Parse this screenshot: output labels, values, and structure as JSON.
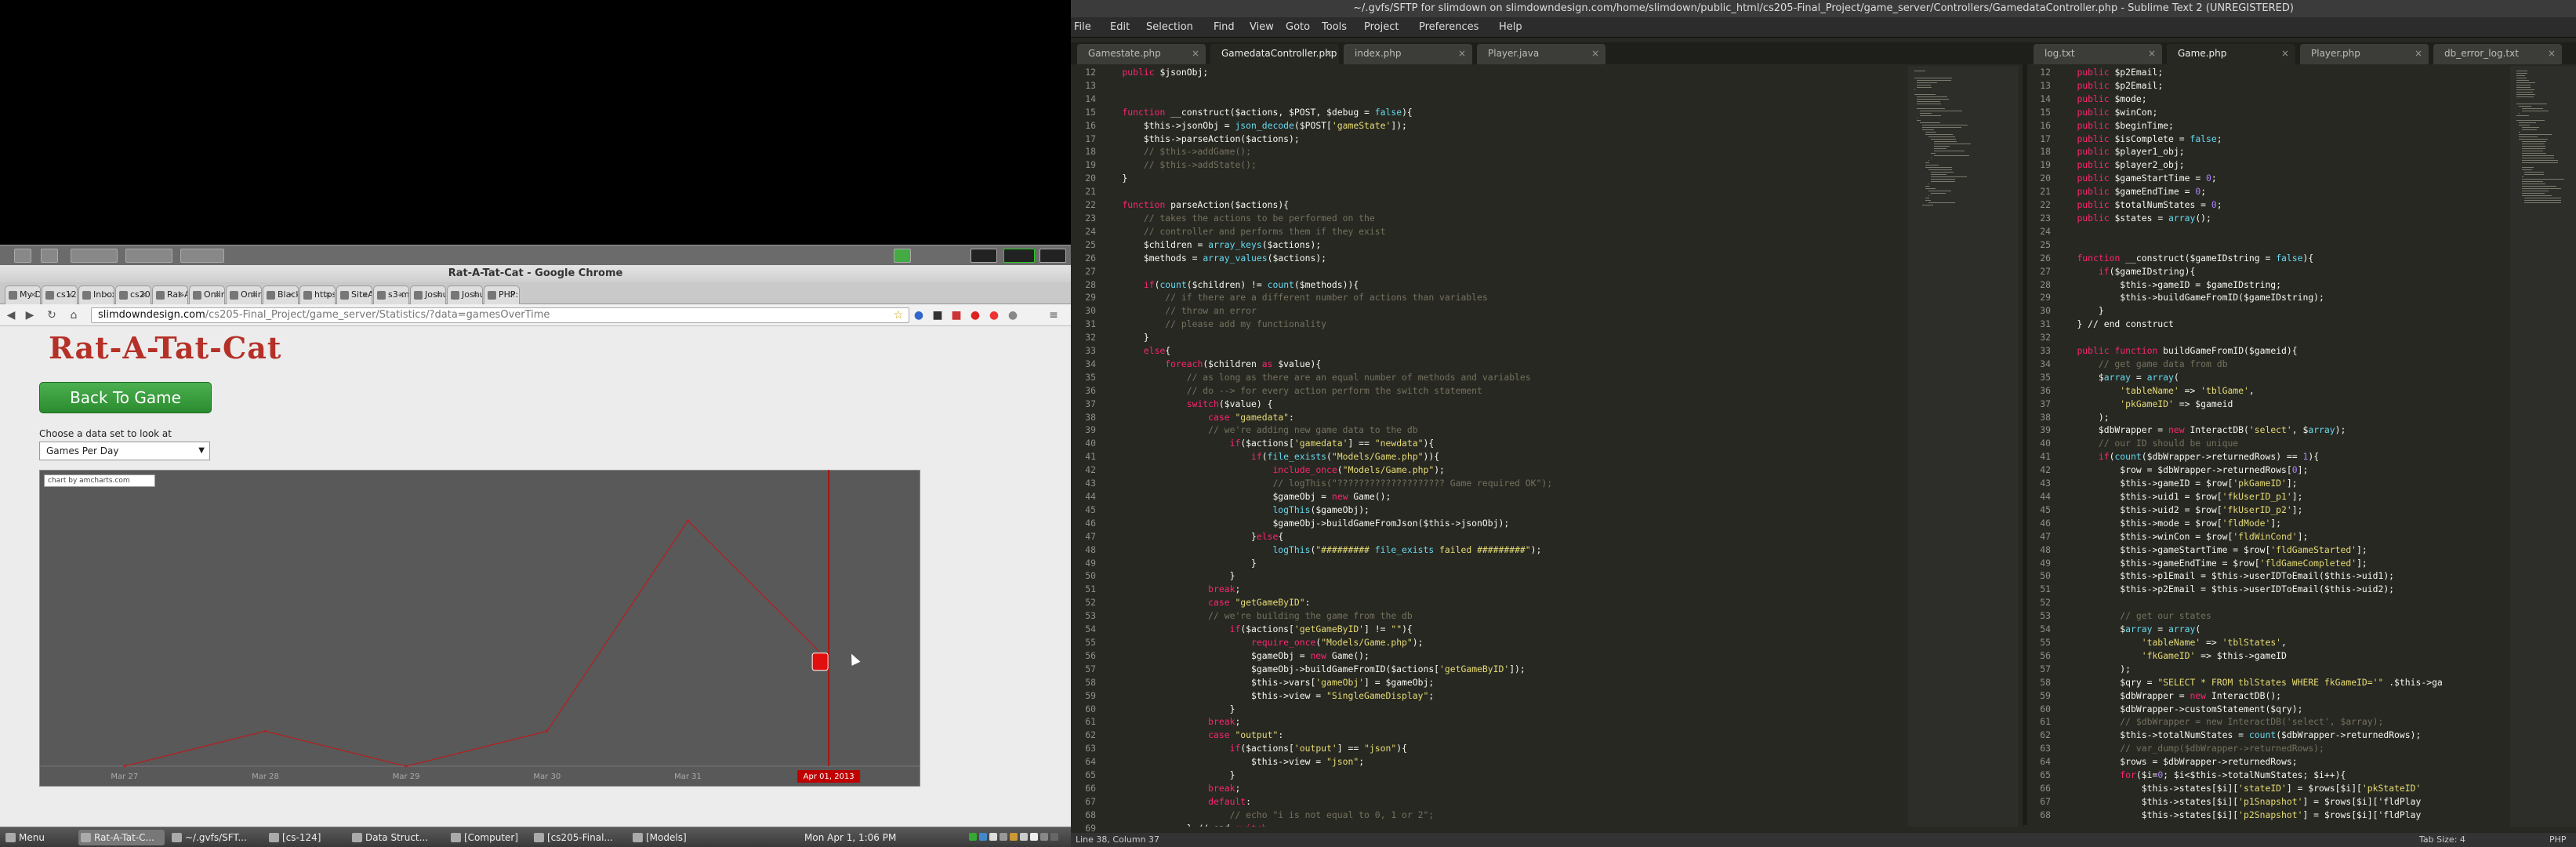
{
  "chrome": {
    "title": "Rat-A-Tat-Cat - Google Chrome",
    "url_host": "slimdowndesign.com",
    "url_path": "/cs205-Final_Project/game_server/Statistics/?data=gamesOverTime",
    "tabs": [
      "My Dri",
      "cs124",
      "Inbox (",
      "cs205",
      "Rat-A-",
      "Online",
      "Online",
      "Blackb",
      "https:",
      "SiteAd",
      "s3-myc",
      "Joshua",
      "Joshua",
      "PHP: fil"
    ]
  },
  "page": {
    "logo": "Rat-A-Tat-Cat",
    "back_button": "Back To Game",
    "choose_label": "Choose a data set to look at",
    "dataset_selected": "Games Per Day",
    "credit": "chart by amcharts.com"
  },
  "chart_data": {
    "type": "line",
    "x_labels": [
      "Mar 27",
      "Mar 28",
      "Mar 29",
      "Mar 30",
      "Mar 31",
      "Apr 01, 2013"
    ],
    "series": [
      {
        "values": [
          0,
          1,
          0,
          1,
          7,
          3
        ]
      }
    ],
    "highlight_label": "Apr 01, 2013",
    "colors": {
      "line": "#b32020",
      "background": "#595959",
      "cursor": "#c00000"
    }
  },
  "taskbar": {
    "menu": "Menu",
    "items": [
      "Rat-A-Tat-C...",
      "~/.gvfs/SFT...",
      "[cs-124]",
      "Data Struct...",
      "[Computer]",
      "[cs205-Final...",
      "[Models]"
    ],
    "clock": "Mon Apr 1, 1:06 PM"
  },
  "sublime": {
    "title": "~/.gvfs/SFTP for slimdown on slimdowndesign.com/home/slimdown/public_html/cs205-Final_Project/game_server/Controllers/GamedataController.php - Sublime Text 2 (UNREGISTERED)",
    "menu": [
      "File",
      "Edit",
      "Selection",
      "Find",
      "View",
      "Goto",
      "Tools",
      "Project",
      "Preferences",
      "Help"
    ],
    "pane1_tabs": [
      "Gamestate.php",
      "GamedataController.php",
      "index.php",
      "Player.java"
    ],
    "pane1_active": 1,
    "pane2_tabs": [
      "log.txt",
      "Game.php",
      "Player.php",
      "db_error_log.txt"
    ],
    "pane2_active": 1,
    "status_left": "Line 38, Column 37",
    "status_tab": "Tab Size: 4",
    "status_lang": "PHP"
  },
  "pane1_code": [
    {
      "n": "12",
      "t": "    public $jsonObj;"
    },
    {
      "n": "13",
      "t": ""
    },
    {
      "n": "14",
      "t": ""
    },
    {
      "n": "15",
      "t": "    function __construct($actions, $POST, $debug = false){"
    },
    {
      "n": "16",
      "t": "        $this->jsonObj = json_decode($POST['gameState']);"
    },
    {
      "n": "17",
      "t": "        $this->parseAction($actions);"
    },
    {
      "n": "18",
      "t": "        // $this->addGame();"
    },
    {
      "n": "19",
      "t": "        // $this->addState();"
    },
    {
      "n": "20",
      "t": "    }"
    },
    {
      "n": "21",
      "t": ""
    },
    {
      "n": "22",
      "t": "    function parseAction($actions){"
    },
    {
      "n": "23",
      "t": "        // takes the actions to be performed on the"
    },
    {
      "n": "24",
      "t": "        // controller and performs them if they exist"
    },
    {
      "n": "25",
      "t": "        $children = array_keys($actions);"
    },
    {
      "n": "26",
      "t": "        $methods = array_values($actions);"
    },
    {
      "n": "27",
      "t": ""
    },
    {
      "n": "28",
      "t": "        if(count($children) != count($methods)){"
    },
    {
      "n": "29",
      "t": "            // if there are a different number of actions than variables"
    },
    {
      "n": "30",
      "t": "            // throw an error"
    },
    {
      "n": "31",
      "t": "            // please add my functionality"
    },
    {
      "n": "32",
      "t": "        }"
    },
    {
      "n": "33",
      "t": "        else{"
    },
    {
      "n": "34",
      "t": "            foreach($children as $value){"
    },
    {
      "n": "35",
      "t": "                // as long as there are an equal number of methods and variables"
    },
    {
      "n": "36",
      "t": "                // do --> for every action perform the switch statement"
    },
    {
      "n": "37",
      "t": "                switch($value) {"
    },
    {
      "n": "38",
      "t": "                    case \"gamedata\":"
    },
    {
      "n": "39",
      "t": "                    // we're adding new game data to the db"
    },
    {
      "n": "40",
      "t": "                        if($actions['gamedata'] == \"newdata\"){"
    },
    {
      "n": "41",
      "t": "                            if(file_exists(\"Models/Game.php\")){"
    },
    {
      "n": "42",
      "t": "                                include_once(\"Models/Game.php\");"
    },
    {
      "n": "43",
      "t": "                                // logThis(\"???????????????????? Game required OK\");"
    },
    {
      "n": "44",
      "t": "                                $gameObj = new Game();"
    },
    {
      "n": "45",
      "t": "                                logThis($gameObj);"
    },
    {
      "n": "46",
      "t": "                                $gameObj->buildGameFromJson($this->jsonObj);"
    },
    {
      "n": "47",
      "t": "                            }else{"
    },
    {
      "n": "48",
      "t": "                                logThis(\"######### file_exists failed #########\");"
    },
    {
      "n": "49",
      "t": "                            }"
    },
    {
      "n": "50",
      "t": "                        }"
    },
    {
      "n": "51",
      "t": "                    break;"
    },
    {
      "n": "52",
      "t": "                    case \"getGameByID\":"
    },
    {
      "n": "53",
      "t": "                    // we're building the game from the db"
    },
    {
      "n": "54",
      "t": "                        if($actions['getGameByID'] != \"\"){"
    },
    {
      "n": "55",
      "t": "                            require_once(\"Models/Game.php\");"
    },
    {
      "n": "56",
      "t": "                            $gameObj = new Game();"
    },
    {
      "n": "57",
      "t": "                            $gameObj->buildGameFromID($actions['getGameByID']);"
    },
    {
      "n": "58",
      "t": "                            $this->vars['gameObj'] = $gameObj;"
    },
    {
      "n": "59",
      "t": "                            $this->view = \"SingleGameDisplay\";"
    },
    {
      "n": "60",
      "t": "                        }"
    },
    {
      "n": "61",
      "t": "                    break;"
    },
    {
      "n": "62",
      "t": "                    case \"output\":"
    },
    {
      "n": "63",
      "t": "                        if($actions['output'] == \"json\"){"
    },
    {
      "n": "64",
      "t": "                            $this->view = \"json\";"
    },
    {
      "n": "65",
      "t": "                        }"
    },
    {
      "n": "66",
      "t": "                    break;"
    },
    {
      "n": "67",
      "t": "                    default:"
    },
    {
      "n": "68",
      "t": "                        // echo \"i is not equal to 0, 1 or 2\";"
    },
    {
      "n": "69",
      "t": "                } // end switch"
    }
  ],
  "pane2_code": [
    {
      "n": "12",
      "t": "    public $p2Email;"
    },
    {
      "n": "13",
      "t": "    public $p2Email;"
    },
    {
      "n": "14",
      "t": "    public $mode;"
    },
    {
      "n": "15",
      "t": "    public $winCon;"
    },
    {
      "n": "16",
      "t": "    public $beginTime;"
    },
    {
      "n": "17",
      "t": "    public $isComplete = false;"
    },
    {
      "n": "18",
      "t": "    public $player1_obj;"
    },
    {
      "n": "19",
      "t": "    public $player2_obj;"
    },
    {
      "n": "20",
      "t": "    public $gameStartTime = 0;"
    },
    {
      "n": "21",
      "t": "    public $gameEndTime = 0;"
    },
    {
      "n": "22",
      "t": "    public $totalNumStates = 0;"
    },
    {
      "n": "23",
      "t": "    public $states = array();"
    },
    {
      "n": "24",
      "t": ""
    },
    {
      "n": "25",
      "t": ""
    },
    {
      "n": "26",
      "t": "    function __construct($gameIDstring = false){"
    },
    {
      "n": "27",
      "t": "        if($gameIDstring){"
    },
    {
      "n": "28",
      "t": "            $this->gameID = $gameIDstring;"
    },
    {
      "n": "29",
      "t": "            $this->buildGameFromID($gameIDstring);"
    },
    {
      "n": "30",
      "t": "        }"
    },
    {
      "n": "31",
      "t": "    } // end construct"
    },
    {
      "n": "32",
      "t": ""
    },
    {
      "n": "33",
      "t": "    public function buildGameFromID($gameid){"
    },
    {
      "n": "34",
      "t": "        // get game data from db"
    },
    {
      "n": "35",
      "t": "        $array = array("
    },
    {
      "n": "36",
      "t": "            'tableName' => 'tblGame',"
    },
    {
      "n": "37",
      "t": "            'pkGameID' => $gameid"
    },
    {
      "n": "38",
      "t": "        );"
    },
    {
      "n": "39",
      "t": "        $dbWrapper = new InteractDB('select', $array);"
    },
    {
      "n": "40",
      "t": "        // our ID should be unique"
    },
    {
      "n": "41",
      "t": "        if(count($dbWrapper->returnedRows) == 1){"
    },
    {
      "n": "42",
      "t": "            $row = $dbWrapper->returnedRows[0];"
    },
    {
      "n": "43",
      "t": "            $this->gameID = $row['pkGameID'];"
    },
    {
      "n": "44",
      "t": "            $this->uid1 = $row['fkUserID_p1'];"
    },
    {
      "n": "45",
      "t": "            $this->uid2 = $row['fkUserID_p2'];"
    },
    {
      "n": "46",
      "t": "            $this->mode = $row['fldMode'];"
    },
    {
      "n": "47",
      "t": "            $this->winCon = $row['fldWinCond'];"
    },
    {
      "n": "48",
      "t": "            $this->gameStartTime = $row['fldGameStarted'];"
    },
    {
      "n": "49",
      "t": "            $this->gameEndTime = $row['fldGameCompleted'];"
    },
    {
      "n": "50",
      "t": "            $this->p1Email = $this->userIDToEmail($this->uid1);"
    },
    {
      "n": "51",
      "t": "            $this->p2Email = $this->userIDToEmail($this->uid2);"
    },
    {
      "n": "52",
      "t": ""
    },
    {
      "n": "53",
      "t": "            // get our states"
    },
    {
      "n": "54",
      "t": "            $array = array("
    },
    {
      "n": "55",
      "t": "                'tableName' => 'tblStates',"
    },
    {
      "n": "56",
      "t": "                'fkGameID' => $this->gameID"
    },
    {
      "n": "57",
      "t": "            );"
    },
    {
      "n": "58",
      "t": "            $qry = \"SELECT * FROM tblStates WHERE fkGameID='\" .$this->ga"
    },
    {
      "n": "59",
      "t": "            $dbWrapper = new InteractDB();"
    },
    {
      "n": "60",
      "t": "            $dbWrapper->customStatement($qry);"
    },
    {
      "n": "61",
      "t": "            // $dbWrapper = new InteractDB('select', $array);"
    },
    {
      "n": "62",
      "t": "            $this->totalNumStates = count($dbWrapper->returnedRows);"
    },
    {
      "n": "63",
      "t": "            // var_dump($dbWrapper->returnedRows);"
    },
    {
      "n": "64",
      "t": "            $rows = $dbWrapper->returnedRows;"
    },
    {
      "n": "65",
      "t": "            for($i=0; $i<$this->totalNumStates; $i++){"
    },
    {
      "n": "66",
      "t": "                $this->states[$i]['stateID'] = $rows[$i]['pkStateID'"
    },
    {
      "n": "67",
      "t": "                $this->states[$i]['p1Snapshot'] = $rows[$i]['fldPlay"
    },
    {
      "n": "68",
      "t": "                $this->states[$i]['p2Snapshot'] = $rows[$i]['fldPlay"
    }
  ]
}
